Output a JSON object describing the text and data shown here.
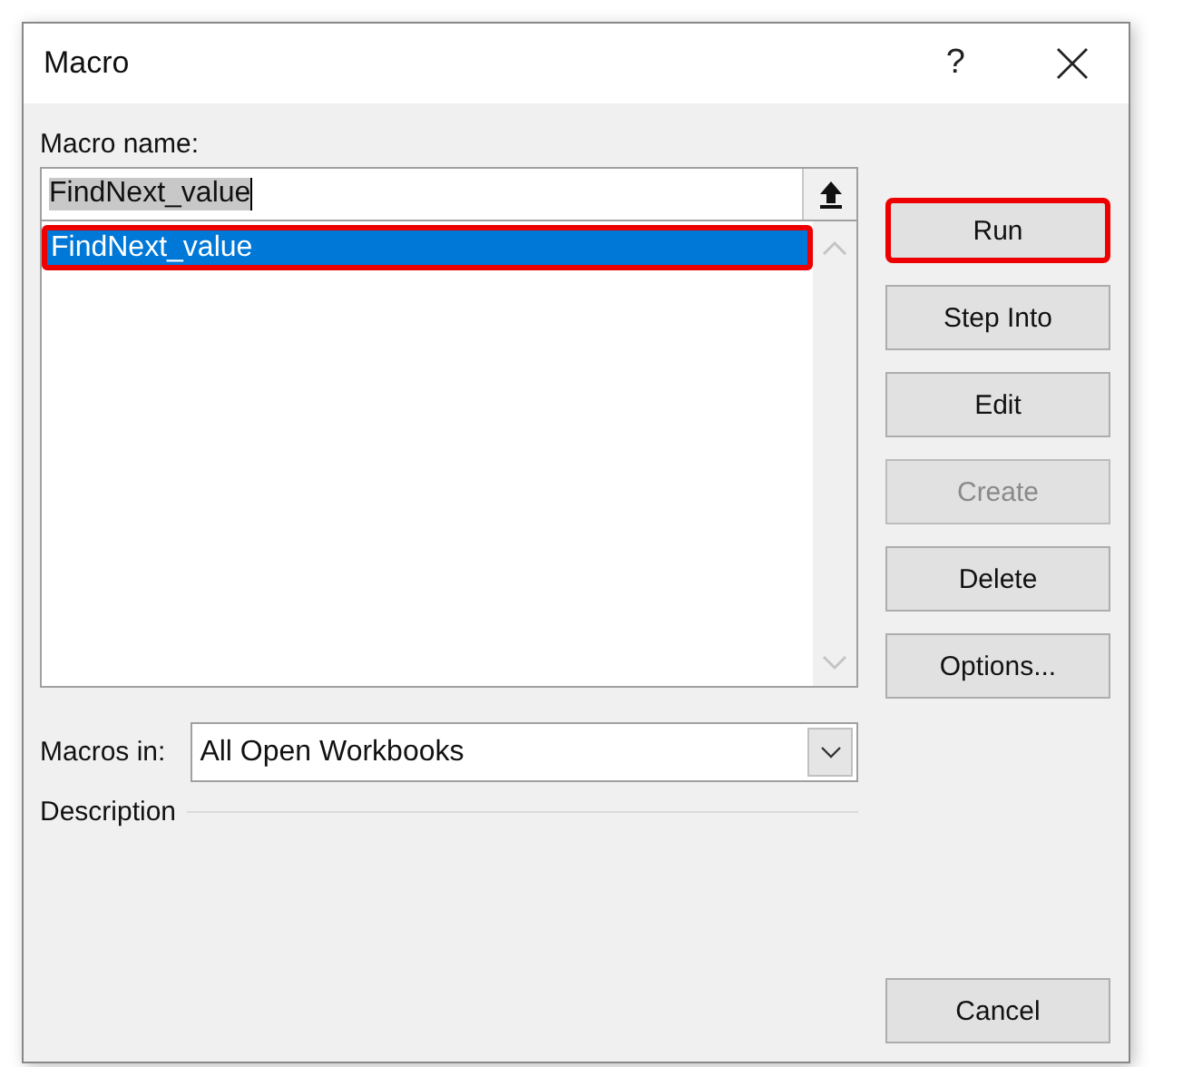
{
  "window": {
    "title": "Macro",
    "help": "?"
  },
  "macro_name": {
    "label": "Macro name:",
    "value": "FindNext_value",
    "value_selected": true
  },
  "macro_list": {
    "items": [
      {
        "label": "FindNext_value",
        "selected": true,
        "highlighted": true
      }
    ]
  },
  "buttons": [
    {
      "label": "Run",
      "disabled": false,
      "highlighted": true
    },
    {
      "label": "Step Into",
      "disabled": false,
      "highlighted": false
    },
    {
      "label": "Edit",
      "disabled": false,
      "highlighted": false
    },
    {
      "label": "Create",
      "disabled": true,
      "highlighted": false
    },
    {
      "label": "Delete",
      "disabled": false,
      "highlighted": false
    },
    {
      "label": "Options...",
      "disabled": false,
      "highlighted": false
    }
  ],
  "macros_in": {
    "label": "Macros in:",
    "value": "All Open Workbooks"
  },
  "description": {
    "label": "Description"
  },
  "cancel_button": {
    "label": "Cancel"
  }
}
